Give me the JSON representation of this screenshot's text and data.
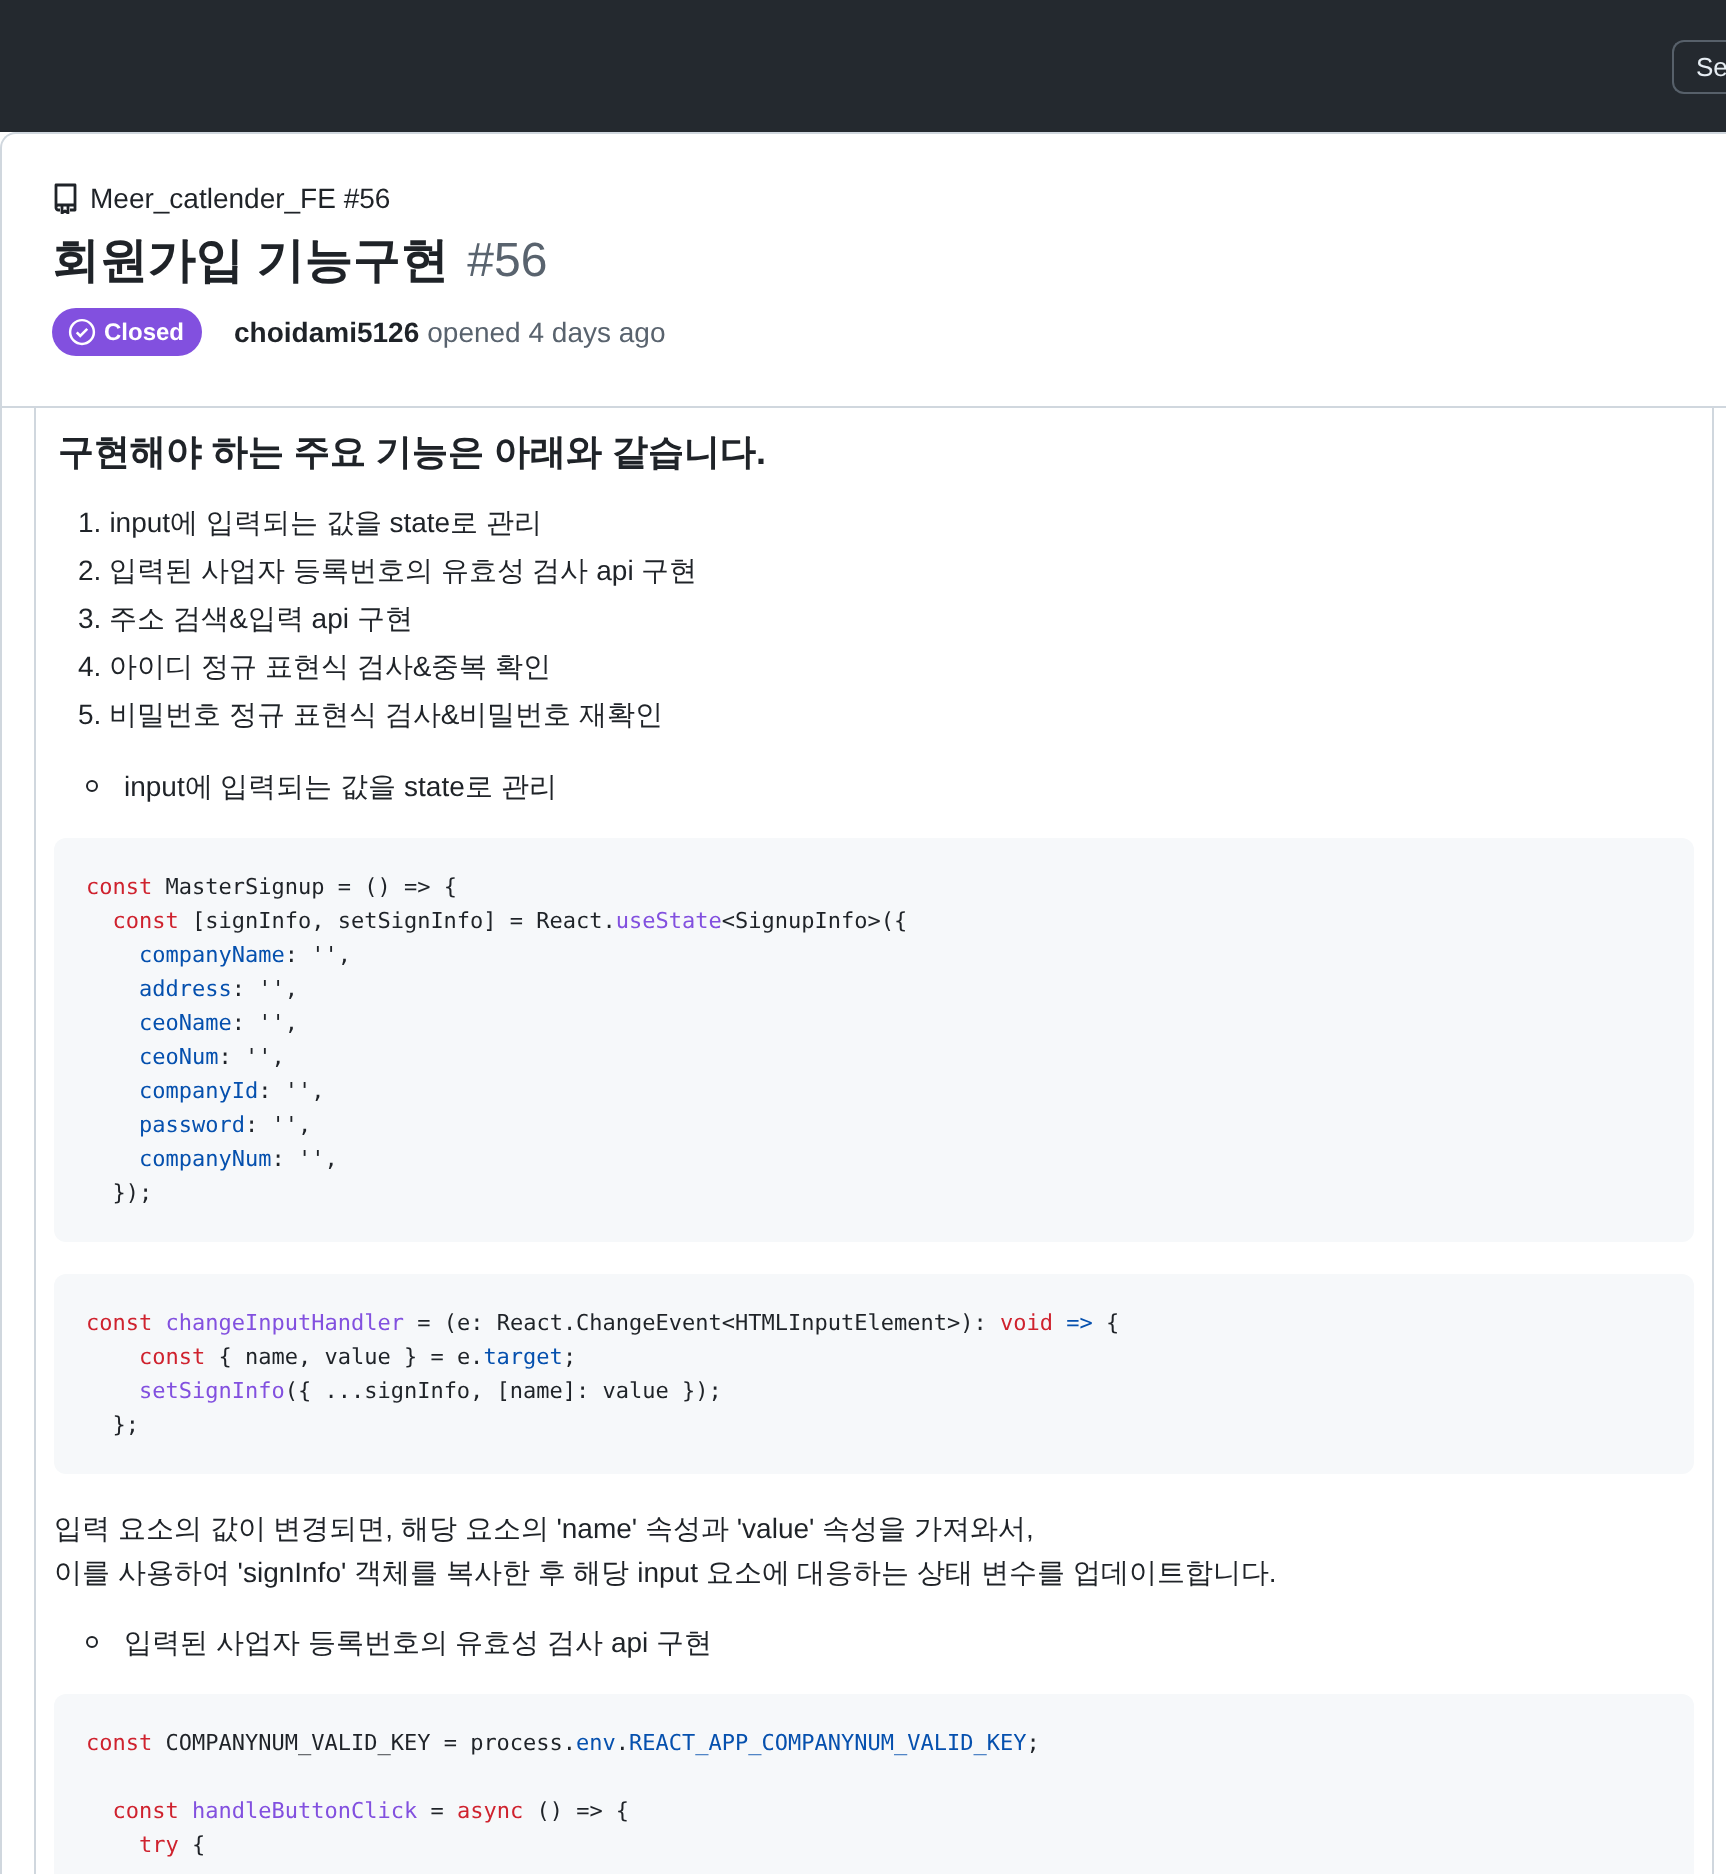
{
  "header": {
    "button_label": "Se"
  },
  "issue": {
    "repo": "Meer_catlender_FE #56",
    "title": "회원가입 기능구현",
    "number": "#56",
    "state": {
      "label": "Closed",
      "kind": "closed"
    },
    "author": "choidami5126",
    "meta": "opened 4 days ago"
  },
  "body": [
    {
      "kind": "heading",
      "text": "구현해야 하는 주요 기능은 아래와 같습니다."
    },
    {
      "kind": "ordered_list",
      "items": [
        {
          "marker": "1.",
          "text": "input에 입력되는 값을 state로 관리"
        },
        {
          "marker": "2.",
          "text": "입력된 사업자 등록번호의 유효성 검사 api 구현"
        },
        {
          "marker": "3.",
          "text": "주소 검색&입력 api 구현"
        },
        {
          "marker": "4.",
          "text": "아이디 정규 표현식 검사&중복 확인"
        },
        {
          "marker": "5.",
          "text": "비밀번호 정규 표현식 검사&비밀번호 재확인"
        }
      ]
    },
    {
      "kind": "bullet_list",
      "items": [
        {
          "text": "input에 입력되는 값을 state로 관리"
        }
      ]
    },
    {
      "kind": "code",
      "lines": [
        {
          "kind": "code",
          "tokens": [
            {
              "t": "const",
              "kind": "kw"
            },
            {
              "t": " MasterSignup = () => {",
              "kind": "plain"
            }
          ]
        },
        {
          "kind": "code",
          "tokens": [
            {
              "t": "  const",
              "kind": "kw"
            },
            {
              "t": " [signInfo, setSignInfo] = React.",
              "kind": "plain"
            },
            {
              "t": "useState",
              "kind": "fn"
            },
            {
              "t": "<SignupInfo>({",
              "kind": "plain"
            }
          ]
        },
        {
          "kind": "code",
          "tokens": [
            {
              "t": "    companyName",
              "kind": "prop"
            },
            {
              "t": ": '',",
              "kind": "plain"
            }
          ]
        },
        {
          "kind": "code",
          "tokens": [
            {
              "t": "    address",
              "kind": "prop"
            },
            {
              "t": ": '',",
              "kind": "plain"
            }
          ]
        },
        {
          "kind": "code",
          "tokens": [
            {
              "t": "    ceoName",
              "kind": "prop"
            },
            {
              "t": ": '',",
              "kind": "plain"
            }
          ]
        },
        {
          "kind": "code",
          "tokens": [
            {
              "t": "    ceoNum",
              "kind": "prop"
            },
            {
              "t": ": '',",
              "kind": "plain"
            }
          ]
        },
        {
          "kind": "code",
          "tokens": [
            {
              "t": "    companyId",
              "kind": "prop"
            },
            {
              "t": ": '',",
              "kind": "plain"
            }
          ]
        },
        {
          "kind": "code",
          "tokens": [
            {
              "t": "    password",
              "kind": "prop"
            },
            {
              "t": ": '',",
              "kind": "plain"
            }
          ]
        },
        {
          "kind": "code",
          "tokens": [
            {
              "t": "    companyNum",
              "kind": "prop"
            },
            {
              "t": ": '',",
              "kind": "plain"
            }
          ]
        },
        {
          "kind": "code",
          "tokens": [
            {
              "t": "  });",
              "kind": "plain"
            }
          ]
        }
      ]
    },
    {
      "kind": "code",
      "lines": [
        {
          "kind": "code",
          "tokens": [
            {
              "t": "const",
              "kind": "kw"
            },
            {
              "t": " changeInputHandler",
              "kind": "fn"
            },
            {
              "t": " = (e: React.ChangeEvent<HTMLInputElement>): ",
              "kind": "plain"
            },
            {
              "t": "void",
              "kind": "kw"
            },
            {
              "t": " =>",
              "kind": "prop"
            },
            {
              "t": " {",
              "kind": "plain"
            }
          ]
        },
        {
          "kind": "code",
          "tokens": [
            {
              "t": "    const",
              "kind": "kw"
            },
            {
              "t": " { name, value } = e.",
              "kind": "plain"
            },
            {
              "t": "target",
              "kind": "prop"
            },
            {
              "t": ";",
              "kind": "plain"
            }
          ]
        },
        {
          "kind": "code",
          "tokens": [
            {
              "t": "    setSignInfo",
              "kind": "fn"
            },
            {
              "t": "({ ...signInfo, [name]: value });",
              "kind": "plain"
            }
          ]
        },
        {
          "kind": "code",
          "tokens": [
            {
              "t": "  };",
              "kind": "plain"
            }
          ]
        }
      ]
    },
    {
      "kind": "paragraph",
      "text": "입력 요소의 값이 변경되면, 해당 요소의 'name' 속성과 'value' 속성을 가져와서,\n이를 사용하여 'signInfo' 객체를 복사한 후 해당 input 요소에 대응하는 상태 변수를 업데이트합니다."
    },
    {
      "kind": "bullet_list",
      "items": [
        {
          "text": "입력된 사업자 등록번호의 유효성 검사 api 구현"
        }
      ]
    },
    {
      "kind": "code",
      "lines": [
        {
          "kind": "code",
          "tokens": [
            {
              "t": "const",
              "kind": "kw"
            },
            {
              "t": " COMPANYNUM_VALID_KEY = process.",
              "kind": "plain"
            },
            {
              "t": "env",
              "kind": "prop"
            },
            {
              "t": ".",
              "kind": "plain"
            },
            {
              "t": "REACT_APP_COMPANYNUM_VALID_KEY",
              "kind": "prop"
            },
            {
              "t": ";",
              "kind": "plain"
            }
          ]
        },
        {
          "kind": "blank"
        },
        {
          "kind": "code",
          "tokens": [
            {
              "t": "  const",
              "kind": "kw"
            },
            {
              "t": " handleButtonClick",
              "kind": "fn"
            },
            {
              "t": " = ",
              "kind": "plain"
            },
            {
              "t": "async",
              "kind": "kw"
            },
            {
              "t": " () => {",
              "kind": "plain"
            }
          ]
        },
        {
          "kind": "code",
          "tokens": [
            {
              "t": "    try",
              "kind": "kw"
            },
            {
              "t": " {",
              "kind": "plain"
            }
          ]
        }
      ]
    }
  ]
}
